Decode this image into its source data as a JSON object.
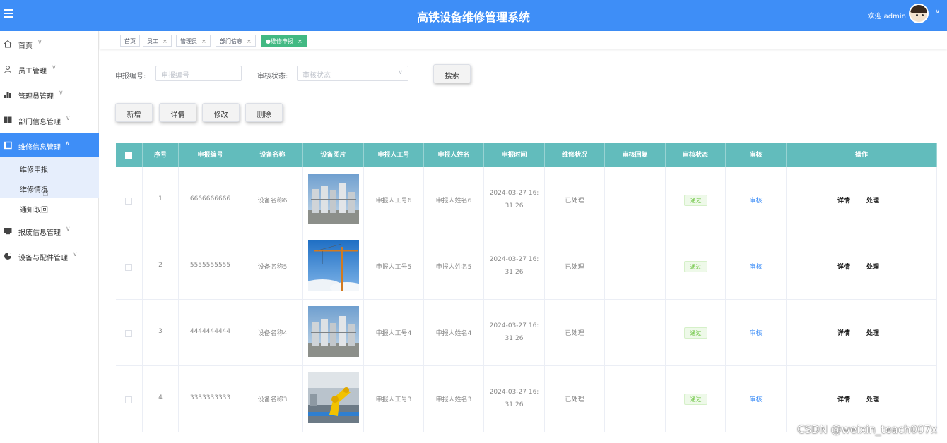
{
  "header": {
    "title": "高铁设备维修管理系统",
    "welcome": "欢迎 admin"
  },
  "sidebar": {
    "items": [
      {
        "label": "首页",
        "icon": "home-icon"
      },
      {
        "label": "员工管理",
        "icon": "user-icon"
      },
      {
        "label": "管理员管理",
        "icon": "chart-icon"
      },
      {
        "label": "部门信息管理",
        "icon": "book-icon"
      },
      {
        "label": "维修信息管理",
        "icon": "panel-icon",
        "active": true
      },
      {
        "label": "报废信息管理",
        "icon": "monitor-icon"
      },
      {
        "label": "设备与配件管理",
        "icon": "pie-icon"
      }
    ],
    "submenu": [
      "维修申报",
      "维修情况",
      "通知取回"
    ]
  },
  "tabs": [
    {
      "label": "首页"
    },
    {
      "label": "员工"
    },
    {
      "label": "管理员"
    },
    {
      "label": "部门信息"
    },
    {
      "label": "●维修申报",
      "active": true
    }
  ],
  "filters": {
    "code_label": "申报编号:",
    "code_placeholder": "申报编号",
    "status_label": "审核状态:",
    "status_placeholder": "审核状态",
    "search_button": "搜索"
  },
  "actions": {
    "add": "新增",
    "detail": "详情",
    "edit": "修改",
    "delete": "删除"
  },
  "table": {
    "columns": [
      "序号",
      "申报编号",
      "设备名称",
      "设备图片",
      "申报人工号",
      "申报人姓名",
      "申报时间",
      "维修状况",
      "审核回复",
      "审核状态",
      "审核",
      "操作"
    ],
    "rows": [
      {
        "no": "1",
        "code": "6666666666",
        "name": "设备名称6",
        "image": "industrial-plant",
        "emp_no": "申报人工号6",
        "emp_name": "申报人姓名6",
        "time_date": "2024-03-27 16:",
        "time_clock": "31:26",
        "repair": "已处理",
        "reply": "",
        "status": "通过",
        "audit": "审核",
        "op_detail": "详情",
        "op_handle": "处理"
      },
      {
        "no": "2",
        "code": "5555555555",
        "name": "设备名称5",
        "image": "tower-crane",
        "emp_no": "申报人工号5",
        "emp_name": "申报人姓名5",
        "time_date": "2024-03-27 16:",
        "time_clock": "31:26",
        "repair": "已处理",
        "reply": "",
        "status": "通过",
        "audit": "审核",
        "op_detail": "详情",
        "op_handle": "处理"
      },
      {
        "no": "3",
        "code": "4444444444",
        "name": "设备名称4",
        "image": "industrial-plant",
        "emp_no": "申报人工号4",
        "emp_name": "申报人姓名4",
        "time_date": "2024-03-27 16:",
        "time_clock": "31:26",
        "repair": "已处理",
        "reply": "",
        "status": "通过",
        "audit": "审核",
        "op_detail": "详情",
        "op_handle": "处理"
      },
      {
        "no": "4",
        "code": "3333333333",
        "name": "设备名称3",
        "image": "robot-arm",
        "emp_no": "申报人工号3",
        "emp_name": "申报人姓名3",
        "time_date": "2024-03-27 16:",
        "time_clock": "31:26",
        "repair": "已处理",
        "reply": "",
        "status": "通过",
        "audit": "审核",
        "op_detail": "详情",
        "op_handle": "处理"
      }
    ]
  },
  "watermark": "CSDN @weixin_teach007x",
  "colors": {
    "primary": "#3e8ef7",
    "table_header": "#62bcbc",
    "active_tab": "#42b983",
    "success": "#67c23a"
  }
}
